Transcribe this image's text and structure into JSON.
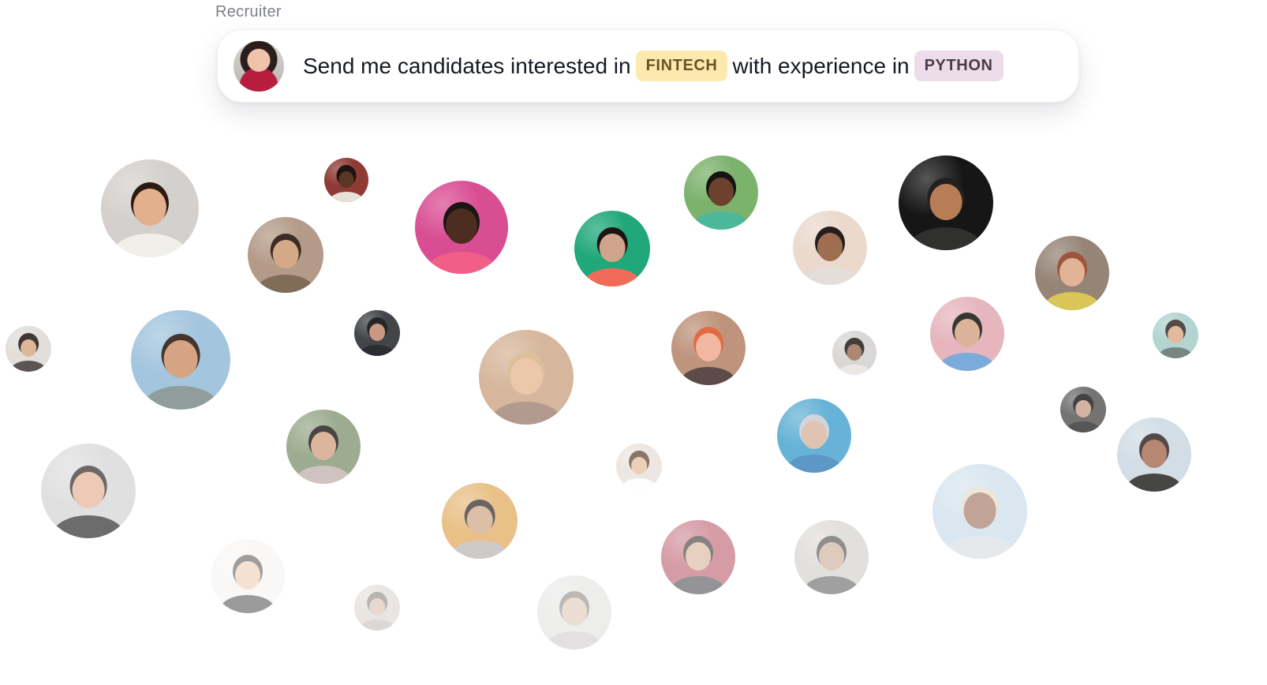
{
  "header": {
    "role_label": "Recruiter"
  },
  "query": {
    "prefix": "Send me candidates interested in",
    "tag1": "FINTECH",
    "middle": "with experience in",
    "tag2": "PYTHON"
  },
  "colors": {
    "fintech_tag": "#fde9ad",
    "python_tag": "#eddcea",
    "text": "#151a21",
    "muted": "#7c7f87"
  },
  "icons": [
    "recruiter-avatar",
    "candidate-avatar"
  ]
}
